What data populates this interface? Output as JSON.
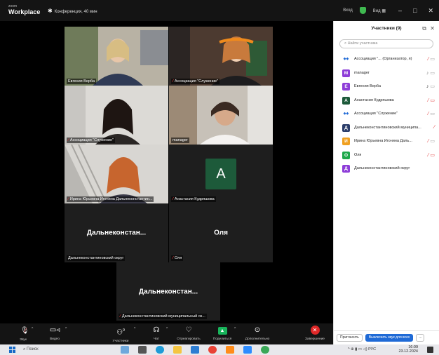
{
  "titlebar": {
    "logo_small": "zoom",
    "logo_big": "Workplace",
    "meeting_title": "Конференция, 40 мин",
    "signin": "Вход",
    "view": "Вид",
    "minimize": "–",
    "maximize": "□",
    "close": "✕"
  },
  "tiles": [
    {
      "name": "Евгения Верба",
      "muted": false
    },
    {
      "name": "Ассоциация \"Служение\"",
      "muted": true
    },
    {
      "name": "Ассоциация \"Служение\"",
      "muted": true
    },
    {
      "name": "manager",
      "muted": false
    },
    {
      "name": "Ирина Юрьевна Игонина Дальнеконстантин...",
      "muted": true
    },
    {
      "name": "Анастасия Кудряшова",
      "muted": true,
      "avatar": "А"
    },
    {
      "name": "Дальнеконстантиновский округ",
      "muted": false,
      "center": "Дальнеконстан..."
    },
    {
      "name": "Оля",
      "muted": true,
      "center": "Оля"
    },
    {
      "name": "Дальнеконстантиновский муниципальный ок...",
      "muted": true,
      "center": "Дальнеконстан..."
    }
  ],
  "panel": {
    "title": "Участники (9)",
    "search_placeholder": "Найти участника",
    "participants": [
      {
        "name": "Ассоциация \"...   (Организатор, я)",
        "avatar": "logo",
        "color": "#1f6ad6"
      },
      {
        "name": "manager",
        "avatar": "M",
        "color": "#8e3ed8"
      },
      {
        "name": "Евгения Верба",
        "avatar": "Е",
        "color": "#8e3ed8"
      },
      {
        "name": "Анастасия Кудряшова",
        "avatar": "А",
        "color": "#1d5a3a"
      },
      {
        "name": "Ассоциация \"Служение\"",
        "avatar": "logo",
        "color": "#1f6ad6"
      },
      {
        "name": "Дальнеконстантиновский муниципа...",
        "avatar": "Д",
        "color": "#2c3e6b"
      },
      {
        "name": "Ирина Юрьевна Игонина Даль...",
        "avatar": "И",
        "color": "#f0a020"
      },
      {
        "name": "Оля",
        "avatar": "О",
        "color": "#1ea84a"
      },
      {
        "name": "Дальнеконстантиновский округ",
        "avatar": "Д",
        "color": "#8e3ed8"
      }
    ],
    "invite": "Пригласить",
    "mute_all": "Выключить звук для всех",
    "more": "..."
  },
  "toolbar": {
    "audio": "Звук",
    "video": "Видео",
    "participants": "Участники",
    "participants_count": "9",
    "chat": "Чат",
    "react": "Отреагировать",
    "share": "Поделиться",
    "more": "Дополнительно",
    "end": "Завершение"
  },
  "taskbar": {
    "search": "Поиск",
    "lang": "РУС",
    "time": "16:09",
    "date": "23.12.2024"
  }
}
